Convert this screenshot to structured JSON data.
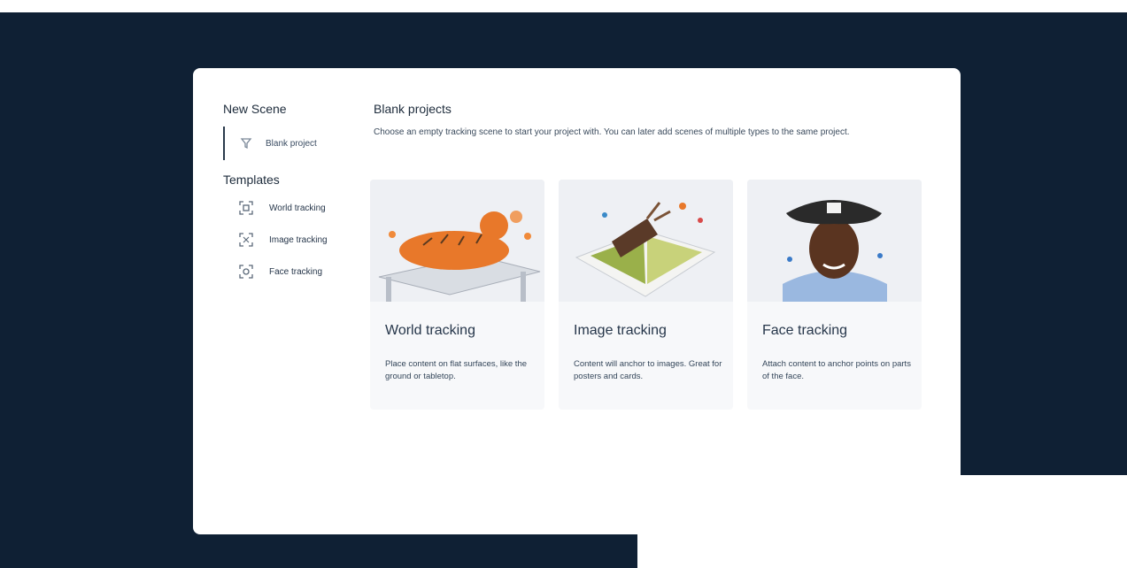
{
  "dialog": {
    "sidebar": {
      "new_scene_title": "New Scene",
      "blank_project_label": "Blank project",
      "templates_title": "Templates",
      "templates": [
        {
          "label": "World tracking",
          "icon": "world-tracking-icon"
        },
        {
          "label": "Image tracking",
          "icon": "image-tracking-icon"
        },
        {
          "label": "Face tracking",
          "icon": "face-tracking-icon"
        }
      ]
    },
    "main": {
      "title": "Blank projects",
      "description": "Choose an empty tracking scene to start your project with. You can later add scenes of multiple types to the same project.",
      "cards": [
        {
          "title": "World tracking",
          "description": "Place content on flat surfaces, like the ground or tabletop."
        },
        {
          "title": "Image tracking",
          "description": "Content will anchor to images. Great for posters and cards."
        },
        {
          "title": "Face tracking",
          "description": "Attach content to anchor points on parts of the face."
        }
      ]
    }
  },
  "colors": {
    "background": "#0f2034",
    "modal": "#ffffff",
    "card": "#f7f8fa",
    "text": "#26364a",
    "accent": "#e8782a"
  }
}
